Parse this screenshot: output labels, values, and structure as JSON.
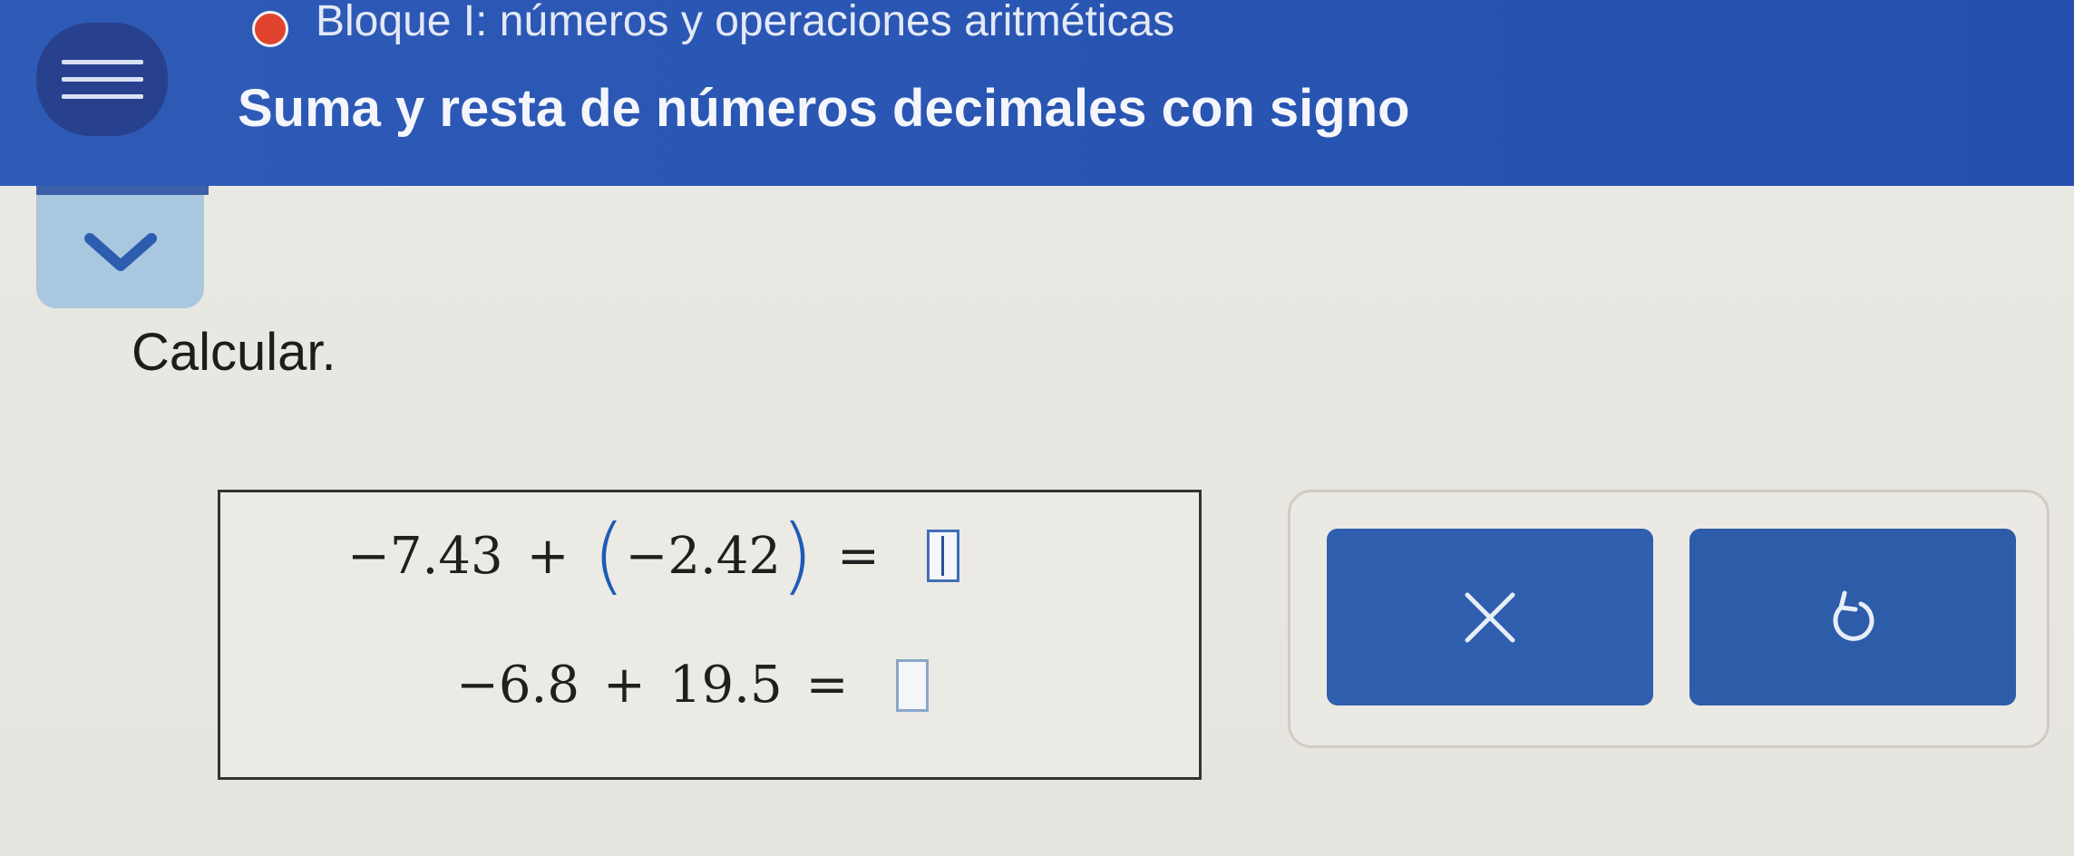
{
  "header": {
    "breadcrumb": "Bloque I: números y operaciones aritméticas",
    "title": "Suma y resta de números decimales con signo",
    "status_color": "#e0442f",
    "menu_icon": "hamburger-icon"
  },
  "expand_toggle": {
    "icon": "chevron-down-icon"
  },
  "instruction": "Calcular.",
  "problems": [
    {
      "left": "−7.43",
      "operator": "+",
      "open_paren": "(",
      "right": "−2.42",
      "close_paren": ")",
      "equals": "=",
      "answer": ""
    },
    {
      "left": "−6.8",
      "operator": "+",
      "right": "19.5",
      "equals": "=",
      "answer": ""
    }
  ],
  "tools": {
    "clear_icon": "close-icon",
    "undo_icon": "undo-icon"
  },
  "colors": {
    "header_bg": "#2a56b4",
    "button_bg": "#2f5fae",
    "accent_paren": "#1e5bb8"
  }
}
